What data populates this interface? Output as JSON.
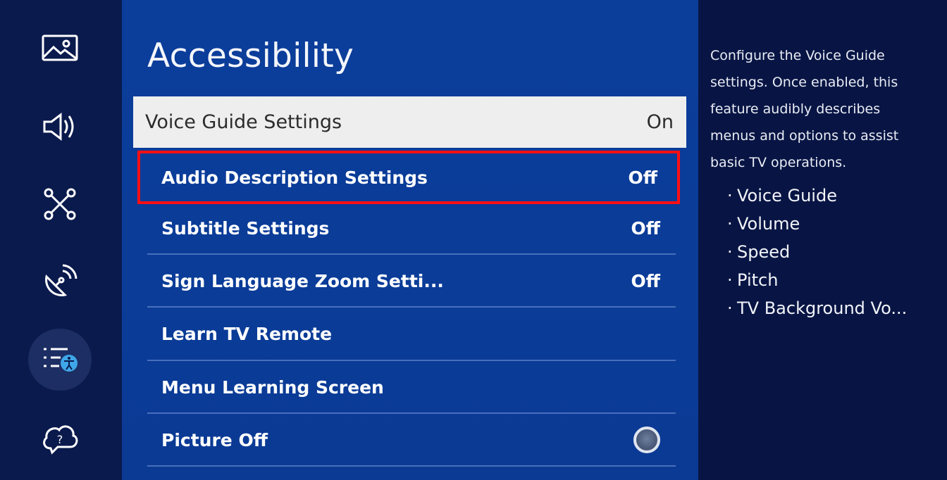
{
  "sidebar": {
    "items": [
      {
        "name": "picture",
        "icon": "picture-icon"
      },
      {
        "name": "sound",
        "icon": "sound-icon"
      },
      {
        "name": "connection",
        "icon": "connection-icon"
      },
      {
        "name": "broadcasting",
        "icon": "broadcasting-icon"
      },
      {
        "name": "general-accessibility",
        "icon": "accessibility-list-icon",
        "active": true
      },
      {
        "name": "support",
        "icon": "support-icon"
      }
    ]
  },
  "main": {
    "title": "Accessibility",
    "items": [
      {
        "label": "Voice Guide Settings",
        "value": "On"
      },
      {
        "label": "Audio Description Settings",
        "value": "Off"
      },
      {
        "label": "Subtitle Settings",
        "value": "Off"
      },
      {
        "label": "Sign Language Zoom Setti...",
        "value": "Off"
      },
      {
        "label": "Learn TV Remote",
        "value": ""
      },
      {
        "label": "Menu Learning Screen",
        "value": ""
      },
      {
        "label": "Picture Off",
        "value": ""
      }
    ]
  },
  "help": {
    "lines": [
      "Configure the Voice Guide",
      "settings. Once enabled, this",
      "feature audibly describes",
      "menus and options to assist",
      "basic TV operations."
    ],
    "bullets": [
      "Voice Guide",
      "Volume",
      "Speed",
      "Pitch",
      "TV Background Vo..."
    ]
  },
  "colors": {
    "panel": "#0b3d9a",
    "highlight_border": "#ff0f13",
    "focused_row": "#eeeeef"
  }
}
